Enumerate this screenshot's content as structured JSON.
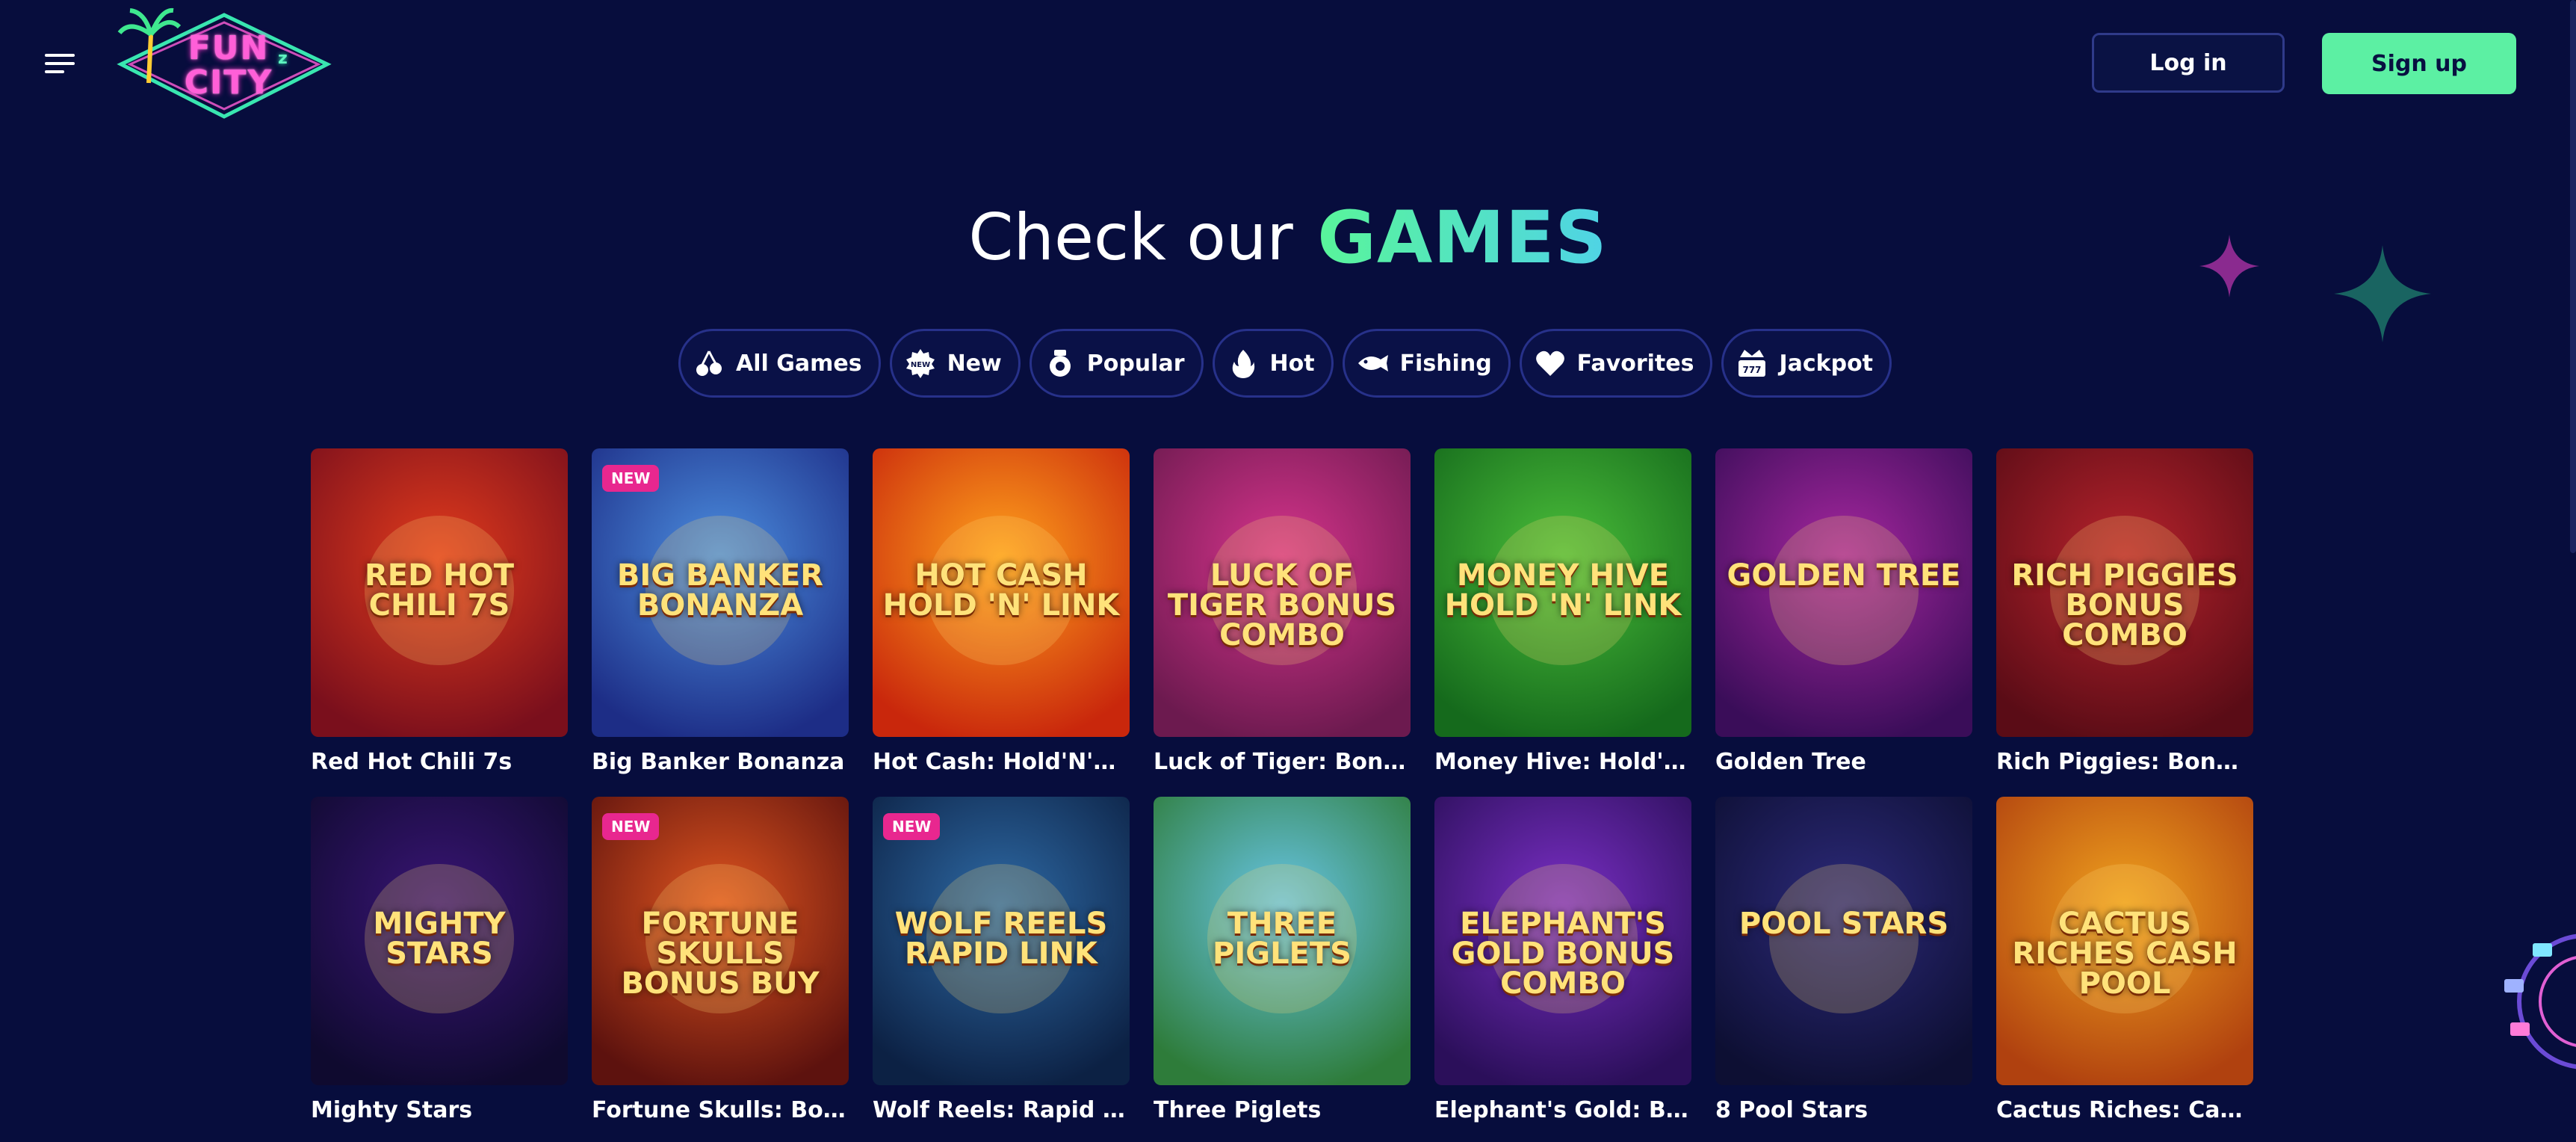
{
  "header": {
    "logo_text_line1": "FUN",
    "logo_text_line2": "CITY",
    "logo_superscript": "z",
    "login_label": "Log in",
    "signup_label": "Sign up"
  },
  "hero": {
    "title_prefix": "Check our",
    "title_highlight": "GAMES"
  },
  "filters": [
    {
      "label": "All Games",
      "icon": "cherry-icon"
    },
    {
      "label": "New",
      "icon": "new-badge-icon"
    },
    {
      "label": "Popular",
      "icon": "popular-icon"
    },
    {
      "label": "Hot",
      "icon": "flame-icon"
    },
    {
      "label": "Fishing",
      "icon": "fish-icon"
    },
    {
      "label": "Favorites",
      "icon": "heart-icon"
    },
    {
      "label": "Jackpot",
      "icon": "jackpot-icon"
    }
  ],
  "games": [
    {
      "name": "Red Hot Chili 7s",
      "art_title": "RED HOT CHILI 7s",
      "badge": "",
      "colors": [
        "#e23b1c",
        "#7a0f1c"
      ]
    },
    {
      "name": "Big Banker Bonanza",
      "art_title": "BIG BANKER BONANZA",
      "badge": "NEW",
      "colors": [
        "#4c8fe0",
        "#1d2d86"
      ]
    },
    {
      "name": "Hot Cash: Hold'N'Link",
      "art_title": "HOT CASH HOLD 'N' LINK",
      "badge": "",
      "colors": [
        "#ffa21c",
        "#c9270c"
      ]
    },
    {
      "name": "Luck of Tiger: Bonus ...",
      "art_title": "LUCK OF TIGER BONUS COMBO",
      "badge": "",
      "colors": [
        "#d7348c",
        "#6c1a4f"
      ]
    },
    {
      "name": "Money Hive: Hold'N'L...",
      "art_title": "MONEY HIVE HOLD 'N' LINK",
      "badge": "",
      "colors": [
        "#4bbf3a",
        "#156a1c"
      ]
    },
    {
      "name": "Golden Tree",
      "art_title": "GOLDEN TREE",
      "badge": "",
      "colors": [
        "#a7279f",
        "#3a0d59"
      ]
    },
    {
      "name": "Rich Piggies: Bonus ...",
      "art_title": "RICH PIGGIES BONUS COMBO",
      "badge": "",
      "colors": [
        "#b8232c",
        "#5a0c16"
      ]
    },
    {
      "name": "Mighty Stars",
      "art_title": "MIGHTY STARS",
      "badge": "",
      "colors": [
        "#3a1576",
        "#0f0a2f"
      ]
    },
    {
      "name": "Fortune Skulls: Bonu...",
      "art_title": "FORTUNE SKULLS BONUS BUY",
      "badge": "NEW",
      "colors": [
        "#e0551f",
        "#5d120e"
      ]
    },
    {
      "name": "Wolf Reels: Rapid Link",
      "art_title": "WOLF REELS RAPID LINK",
      "badge": "NEW",
      "colors": [
        "#2e6aa5",
        "#0c2144"
      ]
    },
    {
      "name": "Three Piglets",
      "art_title": "THREE PIGLETS",
      "badge": "",
      "colors": [
        "#68c5e6",
        "#2e7c3a"
      ]
    },
    {
      "name": "Elephant's Gold: Bon...",
      "art_title": "ELEPHANT'S GOLD BONUS COMBO",
      "badge": "",
      "colors": [
        "#7b2fc6",
        "#2b0f5a"
      ]
    },
    {
      "name": "8 Pool Stars",
      "art_title": "POOL STARS",
      "badge": "",
      "colors": [
        "#2d2a7a",
        "#0d0f33"
      ]
    },
    {
      "name": "Cactus Riches: Cash ...",
      "art_title": "CACTUS RICHES CASH POOL",
      "badge": "",
      "colors": [
        "#f0a21e",
        "#b0410f"
      ]
    }
  ],
  "colors": {
    "background": "#070d3d",
    "accent_green": "#5cf0a3",
    "chip_border": "#27318a",
    "badge_pink": "#e8278f"
  }
}
